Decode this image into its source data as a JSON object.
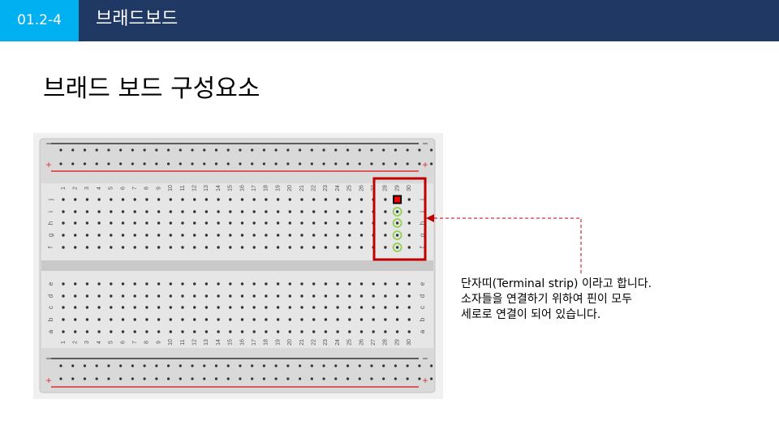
{
  "header": {
    "section_number": "01.2-4",
    "title": "브래드보드"
  },
  "slide_title": "브래드 보드 구성요소",
  "breadboard": {
    "columns": [
      "1",
      "2",
      "3",
      "4",
      "5",
      "6",
      "7",
      "8",
      "9",
      "10",
      "11",
      "12",
      "13",
      "14",
      "15",
      "16",
      "17",
      "18",
      "19",
      "20",
      "21",
      "22",
      "23",
      "24",
      "25",
      "26",
      "27",
      "28",
      "29",
      "30"
    ],
    "rows_top": [
      "j",
      "i",
      "h",
      "g",
      "f"
    ],
    "rows_bottom": [
      "e",
      "d",
      "c",
      "b",
      "a"
    ],
    "rail_minus": "−",
    "rail_plus": "+",
    "highlight_column": "29",
    "colors": {
      "highlight": "#c00000",
      "selected_hole": "#ff0000",
      "connected_ring": "#92d050",
      "rail_red": "#e03030",
      "rail_dark": "#333333"
    }
  },
  "callout": {
    "lines": [
      "단자띠(Terminal strip) 이라고 합니다.",
      "소자들을 연결하기 위하여 핀이 모두",
      "세로로 연결이 되어 있습니다."
    ],
    "arrow_color": "#c00000"
  }
}
